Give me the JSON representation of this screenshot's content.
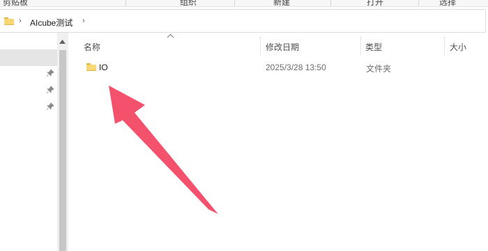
{
  "ribbon": {
    "items": [
      "剪贴板",
      "组织",
      "新建",
      "打开",
      "选择"
    ]
  },
  "addressbar": {
    "folder_icon": "folder-icon",
    "breadcrumb_sep": "›",
    "current_folder": "AIcube测试",
    "dropdown_chevron": "›"
  },
  "navpane": {
    "pin_icon": "pin-icon",
    "scroll_up": "^"
  },
  "columns": {
    "name": "名称",
    "modified": "修改日期",
    "type": "类型",
    "size": "大小",
    "sort_indicator": "^"
  },
  "files": [
    {
      "name": "IO",
      "modified": "2025/3/28 13:50",
      "type": "文件夹",
      "icon": "folder-icon"
    }
  ],
  "annotation": {
    "arrow_color": "#f4516c"
  }
}
